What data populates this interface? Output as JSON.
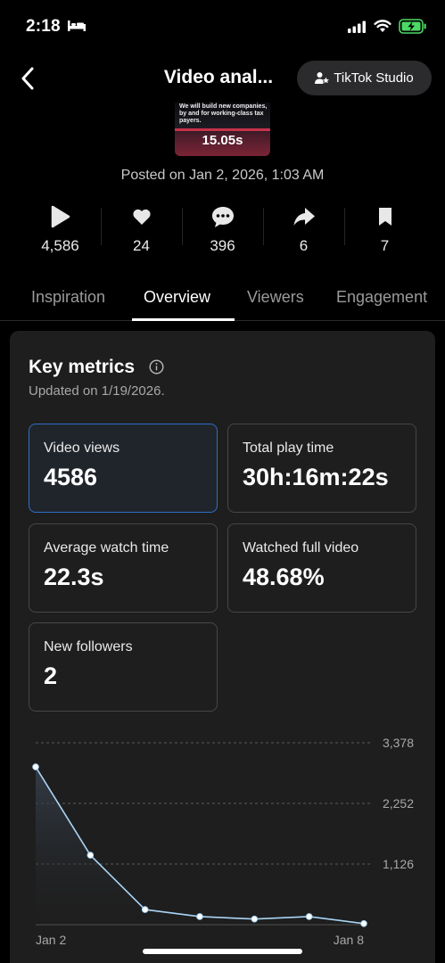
{
  "status_bar": {
    "time": "2:18",
    "icons": [
      "bed-icon",
      "signal-icon",
      "wifi-icon",
      "battery-charging-icon"
    ],
    "battery_color": "#4cd964"
  },
  "header": {
    "title": "Video anal...",
    "studio_button": "TikTok Studio"
  },
  "thumbnail": {
    "caption": "We will build new companies, by and for working-class tax payers.",
    "duration": "15.05s"
  },
  "posted": "Posted on Jan 2, 2026, 1:03 AM",
  "stats": [
    {
      "icon": "play-icon",
      "value": "4,586"
    },
    {
      "icon": "heart-icon",
      "value": "24"
    },
    {
      "icon": "comment-icon",
      "value": "396"
    },
    {
      "icon": "share-icon",
      "value": "6"
    },
    {
      "icon": "bookmark-icon",
      "value": "7"
    }
  ],
  "tabs": [
    {
      "label": "Inspiration",
      "active": false
    },
    {
      "label": "Overview",
      "active": true
    },
    {
      "label": "Viewers",
      "active": false
    },
    {
      "label": "Engagement",
      "active": false
    }
  ],
  "key_metrics": {
    "title": "Key metrics",
    "updated": "Updated on 1/19/2026.",
    "items": [
      {
        "label": "Video views",
        "value": "4586",
        "selected": true
      },
      {
        "label": "Total play time",
        "value": "30h:16m:22s",
        "selected": false
      },
      {
        "label": "Average watch time",
        "value": "22.3s",
        "selected": false
      },
      {
        "label": "Watched full video",
        "value": "48.68%",
        "selected": false
      },
      {
        "label": "New followers",
        "value": "2",
        "selected": false
      }
    ]
  },
  "chart_data": {
    "type": "area",
    "x": [
      "Jan 2",
      "Jan 3",
      "Jan 4",
      "Jan 5",
      "Jan 6",
      "Jan 7",
      "Jan 8"
    ],
    "x_tick_labels": [
      "Jan 2",
      "Jan 8"
    ],
    "values": [
      2930,
      1290,
      280,
      150,
      105,
      150,
      20
    ],
    "y_ticks": [
      1126,
      2252,
      3378
    ],
    "y_tick_labels": [
      "1,126",
      "2,252",
      "3,378"
    ],
    "ylim": [
      0,
      3378
    ],
    "grid": true,
    "line_color": "#a9d4f5"
  }
}
